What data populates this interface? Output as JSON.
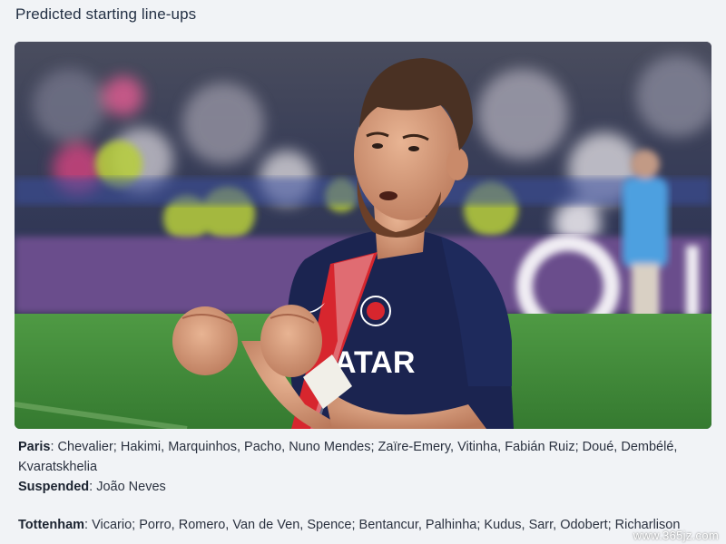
{
  "section": {
    "title": "Predicted starting line-ups"
  },
  "photo": {
    "jersey_sponsor": "ATAR"
  },
  "lineups": {
    "paris": {
      "team": "Paris",
      "players": ": Chevalier; Hakimi, Marquinhos, Pacho, Nuno Mendes; Zaïre-Emery, Vitinha, Fabián Ruiz; Doué, Dembélé, Kvaratskhelia"
    },
    "suspended": {
      "label": "Suspended",
      "players": ": João Neves"
    },
    "tottenham": {
      "team": "Tottenham",
      "players": ": Vicario; Porro, Romero, Van de Ven, Spence; Bentancur, Palhinha; Kudus, Sarr, Odobert; Richarlison"
    }
  },
  "watermark": "www.365jz.com",
  "colors": {
    "page_background": "#f1f3f6",
    "jersey_navy": "#1b2450",
    "jersey_red": "#d7262e",
    "pitch_green": "#3f8a3a"
  }
}
